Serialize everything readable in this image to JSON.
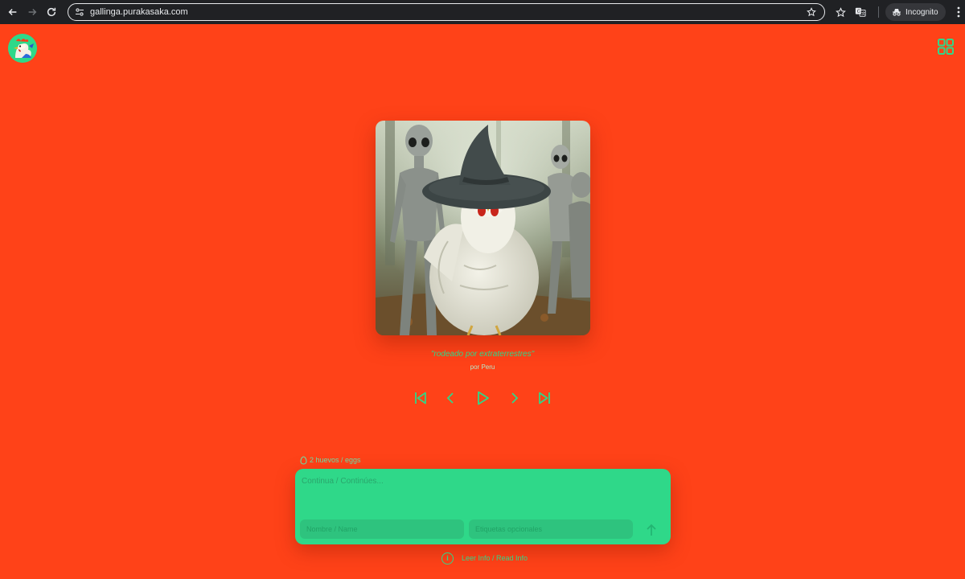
{
  "browser": {
    "url": "gallinga.purakasaka.com",
    "incognito_label": "Incognito"
  },
  "header": {
    "logo_icon": "rooster-logo-icon",
    "menu_icon": "grid-icon"
  },
  "artwork": {
    "caption": "\"rodeado por extraterrestres\"",
    "byline": "por Peru"
  },
  "player": {
    "controls": [
      "skip-back-icon",
      "previous-icon",
      "play-icon",
      "next-icon",
      "skip-forward-icon"
    ]
  },
  "composer": {
    "eggs_label": "2 huevos / eggs",
    "prompt_placeholder": "Continua / Continúes...",
    "name_placeholder": "Nombre / Name",
    "tag_placeholder": "Etiquetas opcionales"
  },
  "footer": {
    "info_label": "Leer Info / Read Info"
  },
  "colors": {
    "background": "#ff4218",
    "accent": "#2fd889"
  }
}
